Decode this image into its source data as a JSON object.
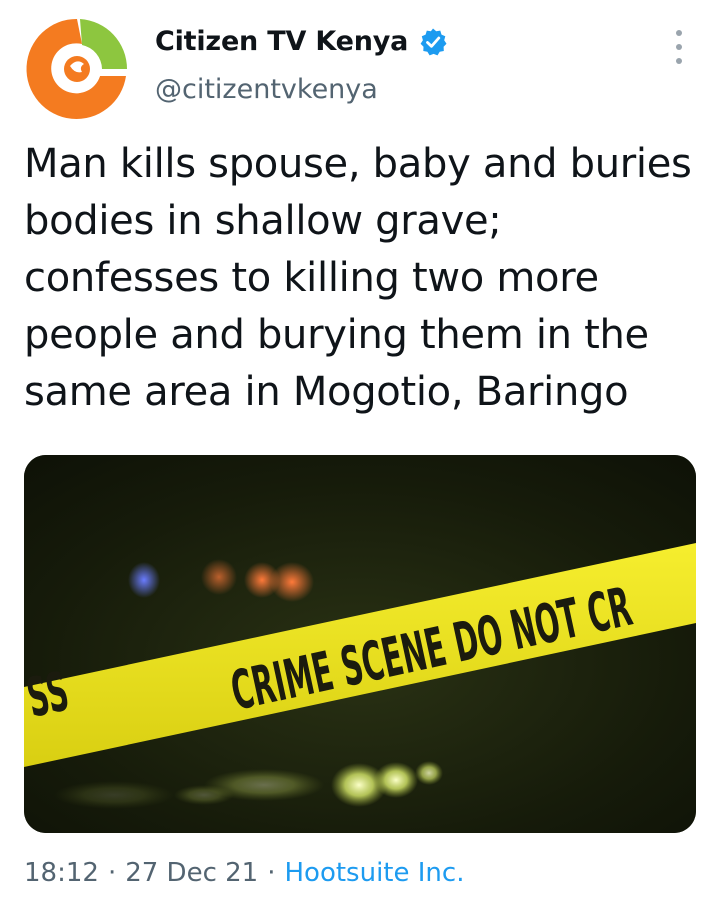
{
  "tweet": {
    "author": {
      "display_name": "Citizen TV Kenya",
      "handle": "@citizentvkenya",
      "verified": true,
      "avatar_icon": "citizen-tv-logo",
      "avatar_colors": {
        "orange": "#f47b20",
        "green": "#8dc63f"
      }
    },
    "more_icon": "vertical-ellipsis-icon",
    "text": "Man kills spouse, baby and buries bodies in shallow grave; confesses to killing two more people and burying them in the same area in Mogotio, Baringo",
    "media": {
      "tape_text": "CRIME SCENE DO NOT CROSS",
      "tape_visible_left": "SS",
      "tape_visible_main": "CRIME SCENE DO NOT CR",
      "colors": {
        "tape": "#f0e71c",
        "tape_text": "#1b1b0e"
      }
    },
    "time": "18:12",
    "separator": "·",
    "date": "27 Dec 21",
    "source": "Hootsuite Inc.",
    "colors": {
      "link": "#1d9bf0",
      "secondary": "#536471",
      "verified": "#1d9bf0"
    }
  }
}
